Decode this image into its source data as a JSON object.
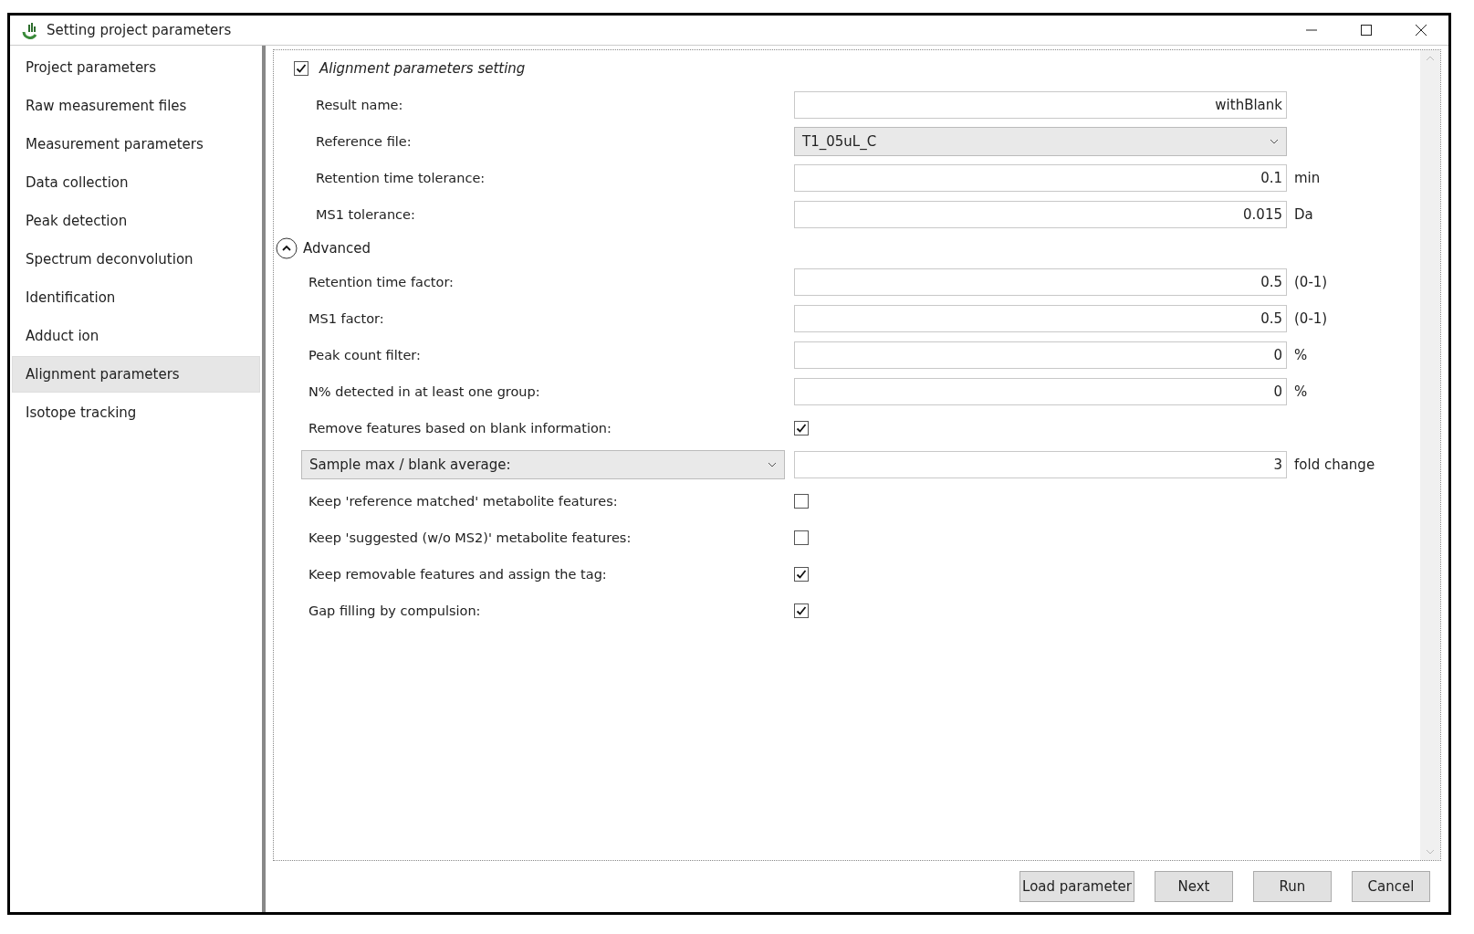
{
  "window": {
    "title": "Setting project parameters"
  },
  "sidebar": {
    "items": [
      {
        "label": "Project parameters",
        "selected": false
      },
      {
        "label": "Raw measurement files",
        "selected": false
      },
      {
        "label": "Measurement parameters",
        "selected": false
      },
      {
        "label": "Data collection",
        "selected": false
      },
      {
        "label": "Peak detection",
        "selected": false
      },
      {
        "label": "Spectrum deconvolution",
        "selected": false
      },
      {
        "label": "Identification",
        "selected": false
      },
      {
        "label": "Adduct ion",
        "selected": false
      },
      {
        "label": "Alignment parameters",
        "selected": true
      },
      {
        "label": "Isotope tracking",
        "selected": false
      }
    ]
  },
  "section": {
    "label": "Alignment parameters setting",
    "checked": true
  },
  "rows": [
    {
      "kind": "text",
      "label": "Result name:",
      "value": "withBlank"
    },
    {
      "kind": "select",
      "label": "Reference file:",
      "value": "T1_05uL_C"
    },
    {
      "kind": "text",
      "label": "Retention time tolerance:",
      "value": "0.1",
      "unit": "min"
    },
    {
      "kind": "text",
      "label": "MS1 tolerance:",
      "value": "0.015",
      "unit": "Da"
    }
  ],
  "advanced": {
    "label": "Advanced",
    "expanded": true,
    "rows": [
      {
        "kind": "text",
        "label": "Retention time factor:",
        "value": "0.5",
        "unit": "(0-1)"
      },
      {
        "kind": "text",
        "label": "MS1 factor:",
        "value": "0.5",
        "unit": "(0-1)"
      },
      {
        "kind": "text",
        "label": "Peak count filter:",
        "value": "0",
        "unit": "%"
      },
      {
        "kind": "text",
        "label": "N% detected in at least one group:",
        "value": "0",
        "unit": "%"
      },
      {
        "kind": "checkbox",
        "label": "Remove features based on blank information:",
        "checked": true
      },
      {
        "kind": "dropdown-text",
        "label": "Sample max / blank average:",
        "value": "3",
        "unit": "fold change"
      },
      {
        "kind": "checkbox",
        "label": "Keep 'reference matched' metabolite features:",
        "checked": false
      },
      {
        "kind": "checkbox",
        "label": "Keep 'suggested (w/o MS2)' metabolite features:",
        "checked": false
      },
      {
        "kind": "checkbox",
        "label": "Keep removable features and assign the tag:",
        "checked": true
      },
      {
        "kind": "checkbox",
        "label": "Gap filling by compulsion:",
        "checked": true
      }
    ]
  },
  "buttons": [
    "Load parameter",
    "Next",
    "Run",
    "Cancel"
  ]
}
